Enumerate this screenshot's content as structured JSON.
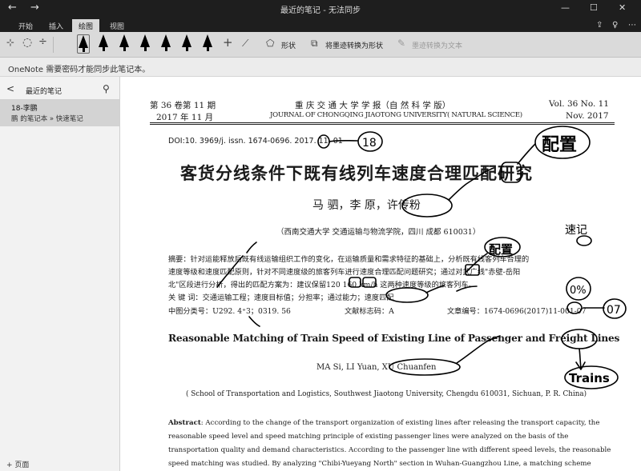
{
  "titlebar": {
    "back": "←",
    "forward": "→",
    "title": "最近的笔记 - 无法同步",
    "minimize": "—",
    "maximize": "☐",
    "close": "✕"
  },
  "ribbon": {
    "tabs": [
      {
        "label": "开始"
      },
      {
        "label": "插入"
      },
      {
        "label": "绘图"
      },
      {
        "label": "视图"
      }
    ],
    "right_icons": {
      "share": "⇪",
      "lightbulb": "♀",
      "more": "⋯"
    }
  },
  "toolbar": {
    "tools": {
      "lasso": "⊹",
      "add_space": "÷",
      "eraser": "◌",
      "ruler": "⟋"
    },
    "add_pen": "+",
    "shapes_label": "形状",
    "ink_to_shape_label": "将墨迹转换为形状",
    "ink_to_text_label": "墨迹转换为文本"
  },
  "notice": {
    "text": "OneNote 需要密码才能同步此笔记本。"
  },
  "sidebar": {
    "back": "<",
    "title": "最近的笔记",
    "search": "⚲",
    "pages": [
      {
        "title": "18-李鹏",
        "subtitle": "鹏 的笔记本 » 快速笔记"
      }
    ],
    "add_page": "+ 页面"
  },
  "document": {
    "header_left_1": "第 36 卷第 11 期",
    "header_left_2": "2017 年 11 月",
    "header_center_1": "重 庆 交 通 大 学 学 报（自 然 科 学 版）",
    "header_center_2": "JOURNAL OF CHONGQING JIAOTONG UNIVERSITY( NATURAL SCIENCE)",
    "header_right_1": "Vol. 36    No. 11",
    "header_right_2": "Nov. 2017",
    "doi": "DOI:10. 3969/j. issn. 1674-0696. 2017. 11. 01",
    "title_zh": "客货分线条件下既有线列车速度合理匹配研究",
    "authors_zh": "马  驷，李  原，许传粉",
    "affiliation_zh": "（西南交通大学 交通运输与物流学院，四川 成都 610031）",
    "abstract_zh_1": "摘要：针对运能释放后既有线运输组织工作的变化，在运输质量和需求特征的基础上，分析既有线客列车合理的",
    "abstract_zh_2": "速度等级和速度匹配原则，针对不同速度级的旅客列车进行速度合理匹配问题研究；通过对武广线\"赤壁-岳阳",
    "abstract_zh_3": "北\"区段进行分析，得出的匹配方案为：建议保留120 160 km/h 这两种速度等级的旅客列车。",
    "keywords_zh": "关  键  词：交通运输工程；速度目标值；分担率；通过能力；速度匹配",
    "clc": "中图分类号：U292. 4⁺3；0319. 56",
    "doc_code": "文献标志码：A",
    "article_no": "文章编号：1674-0696(2017)11-001-07",
    "title_en": "Reasonable Matching of Train Speed of Existing Line of Passenger and Freight Lines",
    "authors_en": "MA Si, LI Yuan, XU Chuanfen",
    "affiliation_en": "( School of Transportation and Logistics, Southwest Jiaotong University, Chengdu 610031,  Sichuan,  P. R. China)",
    "abstract_en_label": "Abstract",
    "abstract_en_1": ": According to the change of the transport organization of existing lines after releasing the transport capacity, the",
    "abstract_en_2": "reasonable speed level and speed matching principle of existing passenger lines were analyzed on the basis of the",
    "abstract_en_3": "transportation quality and demand characteristics. According to the passenger line with different speed levels, the reasonable",
    "abstract_en_4": "speed matching was studied.  By analyzing \"Chibi-Yueyang North\" section in Wuhan-Guangzhou Line, a matching scheme"
  },
  "annotations": {
    "n18": "18",
    "peizhi_1": "配置",
    "peizhi_2": "配置",
    "margin_word": "速记",
    "pct": "0%",
    "n07": "07",
    "trains": "Trains"
  }
}
